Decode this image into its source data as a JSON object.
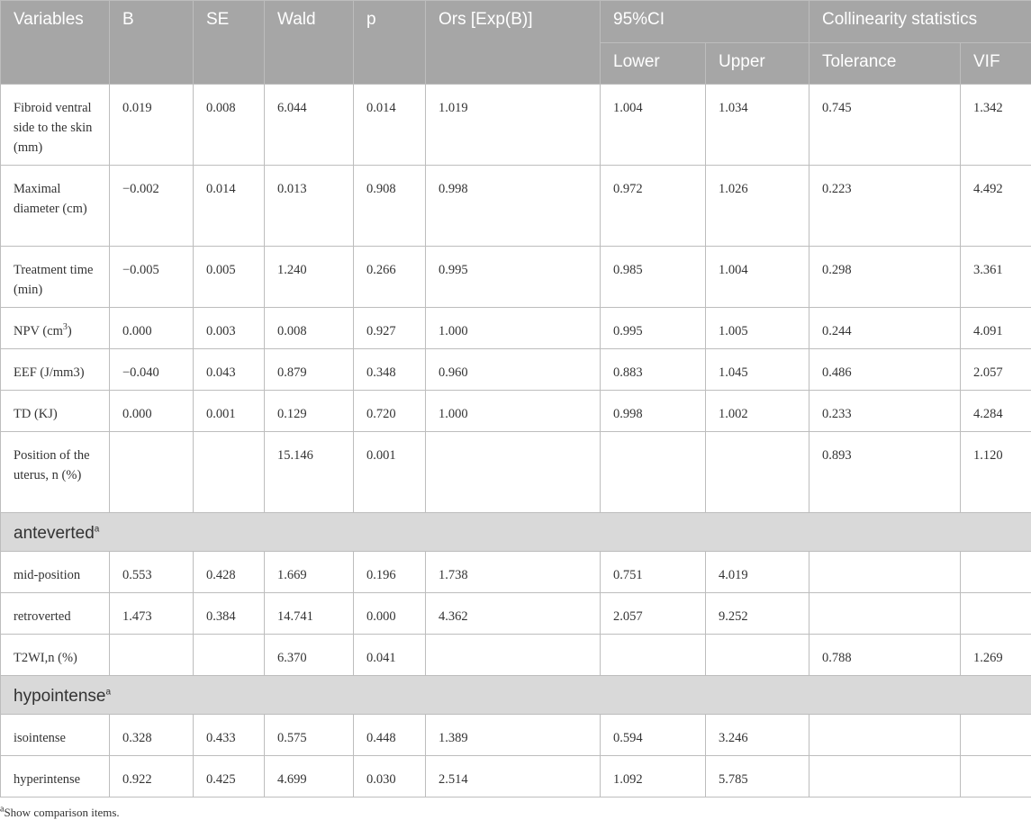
{
  "header": {
    "variables": "Variables",
    "b": "B",
    "se": "SE",
    "wald": "Wald",
    "p": "p",
    "ors": "Ors [Exp(B)]",
    "ci": "95%CI",
    "collinearity": "Collinearity statistics",
    "lower": "Lower",
    "upper": "Upper",
    "tolerance": "Tolerance",
    "vif": "VIF"
  },
  "rows": [
    {
      "variable": "Fibroid ventral side to the skin (mm)",
      "b": "0.019",
      "se": "0.008",
      "wald": "6.044",
      "p": "0.014",
      "ors": "1.019",
      "lower": "1.004",
      "upper": "1.034",
      "tolerance": "0.745",
      "vif": "1.342"
    },
    {
      "variable": "Maximal diameter (cm)",
      "b": "−0.002",
      "se": "0.014",
      "wald": "0.013",
      "p": "0.908",
      "ors": "0.998",
      "lower": "0.972",
      "upper": "1.026",
      "tolerance": "0.223",
      "vif": "4.492"
    },
    {
      "variable": "Treatment time (min)",
      "b": "−0.005",
      "se": "0.005",
      "wald": "1.240",
      "p": "0.266",
      "ors": "0.995",
      "lower": "0.985",
      "upper": "1.004",
      "tolerance": "0.298",
      "vif": "3.361"
    },
    {
      "variable_main": "NPV (cm",
      "variable_sup": "3",
      "variable_tail": ")",
      "b": "0.000",
      "se": "0.003",
      "wald": "0.008",
      "p": "0.927",
      "ors": "1.000",
      "lower": "0.995",
      "upper": "1.005",
      "tolerance": "0.244",
      "vif": "4.091"
    },
    {
      "variable": "EEF (J/mm3)",
      "b": "−0.040",
      "se": "0.043",
      "wald": "0.879",
      "p": "0.348",
      "ors": "0.960",
      "lower": "0.883",
      "upper": "1.045",
      "tolerance": "0.486",
      "vif": "2.057"
    },
    {
      "variable": "TD (KJ)",
      "b": "0.000",
      "se": "0.001",
      "wald": "0.129",
      "p": "0.720",
      "ors": "1.000",
      "lower": "0.998",
      "upper": "1.002",
      "tolerance": "0.233",
      "vif": "4.284"
    },
    {
      "variable": "Position of the uterus, n (%)",
      "b": "",
      "se": "",
      "wald": "15.146",
      "p": "0.001",
      "ors": "",
      "lower": "",
      "upper": "",
      "tolerance": "0.893",
      "vif": "1.120"
    },
    {
      "variable": "mid-position",
      "b": "0.553",
      "se": "0.428",
      "wald": "1.669",
      "p": "0.196",
      "ors": "1.738",
      "lower": "0.751",
      "upper": "4.019",
      "tolerance": "",
      "vif": ""
    },
    {
      "variable": "retroverted",
      "b": "1.473",
      "se": "0.384",
      "wald": "14.741",
      "p": "0.000",
      "ors": "4.362",
      "lower": "2.057",
      "upper": "9.252",
      "tolerance": "",
      "vif": ""
    },
    {
      "variable": "T2WI,n (%)",
      "b": "",
      "se": "",
      "wald": "6.370",
      "p": "0.041",
      "ors": "",
      "lower": "",
      "upper": "",
      "tolerance": "0.788",
      "vif": "1.269"
    },
    {
      "variable": "isointense",
      "b": "0.328",
      "se": "0.433",
      "wald": "0.575",
      "p": "0.448",
      "ors": "1.389",
      "lower": "0.594",
      "upper": "3.246",
      "tolerance": "",
      "vif": ""
    },
    {
      "variable": "hyperintense",
      "b": "0.922",
      "se": "0.425",
      "wald": "4.699",
      "p": "0.030",
      "ors": "2.514",
      "lower": "1.092",
      "upper": "5.785",
      "tolerance": "",
      "vif": ""
    }
  ],
  "groups": [
    {
      "label": "anteverted",
      "marker": "a"
    },
    {
      "label": "hypointense",
      "marker": "a"
    }
  ],
  "footnote": {
    "marker": "a",
    "text": "Show comparison items."
  },
  "colors": {
    "header_bg": "#a6a6a6",
    "group_bg": "#d9d9d9",
    "border": "#bdbdbd"
  }
}
